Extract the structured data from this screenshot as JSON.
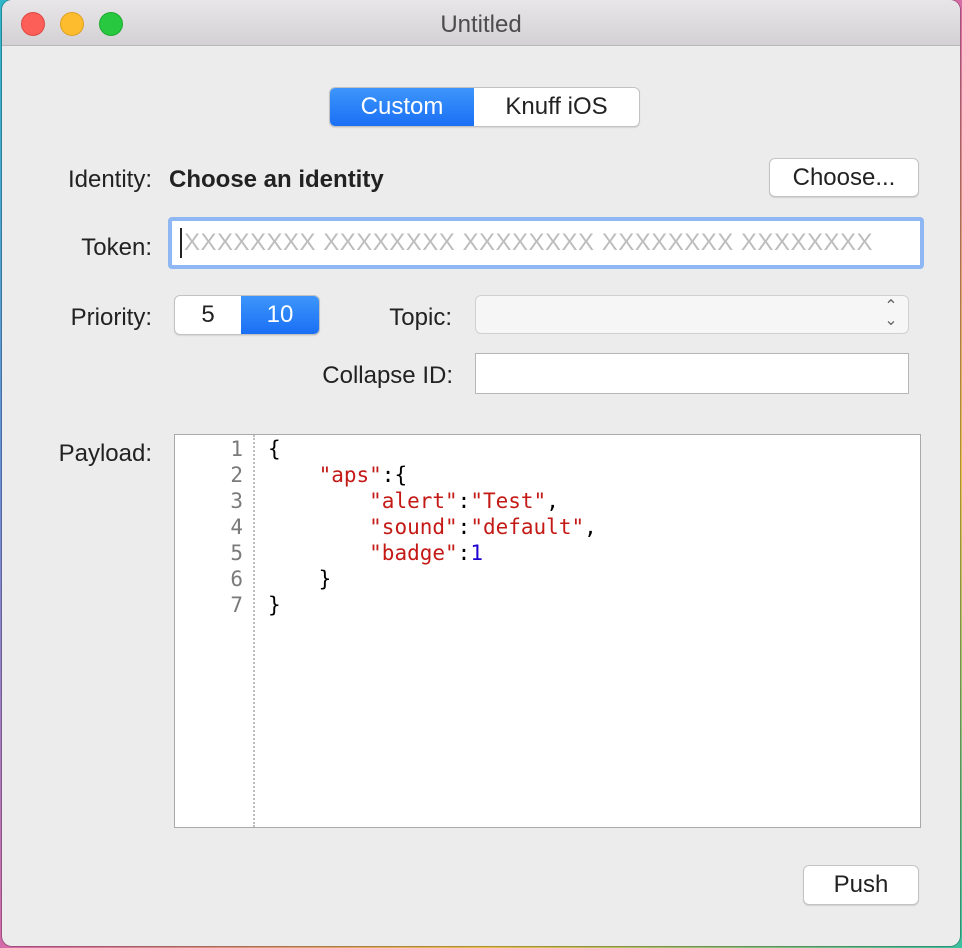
{
  "window": {
    "title": "Untitled"
  },
  "mode_tabs": [
    {
      "label": "Custom",
      "selected": true
    },
    {
      "label": "Knuff iOS",
      "selected": false
    }
  ],
  "identity": {
    "label": "Identity:",
    "value": "Choose an identity",
    "button": "Choose..."
  },
  "token": {
    "label": "Token:",
    "placeholder": "XXXXXXXX XXXXXXXX XXXXXXXX XXXXXXXX XXXXXXXX",
    "value": ""
  },
  "priority": {
    "label": "Priority:",
    "options": [
      {
        "label": "5",
        "selected": false
      },
      {
        "label": "10",
        "selected": true
      }
    ]
  },
  "topic": {
    "label": "Topic:",
    "value": ""
  },
  "collapse_id": {
    "label": "Collapse ID:",
    "value": ""
  },
  "payload": {
    "label": "Payload:",
    "line_numbers": [
      "1",
      "2",
      "3",
      "4",
      "5",
      "6",
      "7"
    ]
  },
  "push_button": "Push",
  "colors": {
    "accent": "#1a6ff5",
    "focus_ring": "#8fb7f4",
    "json_key": "#c41a16",
    "json_number": "#1c00cf"
  }
}
